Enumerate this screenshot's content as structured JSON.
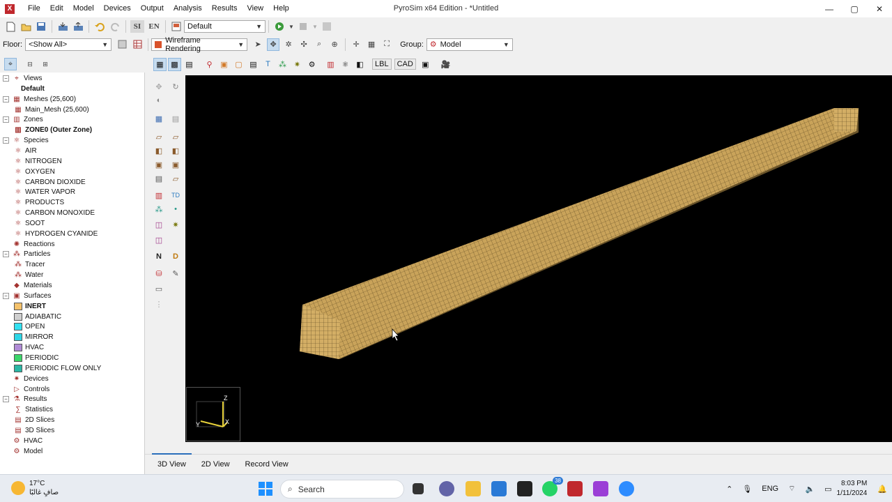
{
  "app": {
    "title": "PyroSim x64 Edition - *Untitled",
    "icon_glyph": "X",
    "menu": [
      "File",
      "Edit",
      "Model",
      "Devices",
      "Output",
      "Analysis",
      "Results",
      "View",
      "Help"
    ],
    "window_controls": [
      "—",
      "▢",
      "✕"
    ]
  },
  "toolbar1": {
    "units_si": "SI",
    "units_en": "EN",
    "view_combo": "Default"
  },
  "toolbar2": {
    "floor_label": "Floor:",
    "floor_value": "<Show All>",
    "render_mode": "Wireframe Rendering",
    "group_label": "Group:",
    "group_value": "Model"
  },
  "toolbar3": {
    "lbl_button": "LBL",
    "cad_button": "CAD"
  },
  "tree": [
    {
      "label": "Views",
      "level": 0,
      "expander": "−",
      "icon": "views-icon",
      "glyph": "⌖"
    },
    {
      "label": "Default",
      "level": 1,
      "bold": true
    },
    {
      "label": "Meshes (25,600)",
      "level": 0,
      "expander": "−",
      "icon": "mesh-icon",
      "glyph": "▦"
    },
    {
      "label": "Main_Mesh (25,600)",
      "level": 1,
      "icon": "mesh-icon",
      "glyph": "▦"
    },
    {
      "label": "Zones",
      "level": 0,
      "expander": "−",
      "icon": "zones-icon",
      "glyph": "▥"
    },
    {
      "label": "ZONE0 (Outer Zone)",
      "level": 1,
      "bold": true,
      "icon": "zone-icon",
      "glyph": "▥"
    },
    {
      "label": "Species",
      "level": 0,
      "expander": "−",
      "icon": "species-icon",
      "glyph": "⚛"
    },
    {
      "label": "AIR",
      "level": 1,
      "icon": "species-icon",
      "glyph": "⚛"
    },
    {
      "label": "NITROGEN",
      "level": 1,
      "icon": "species-icon",
      "glyph": "⚛"
    },
    {
      "label": "OXYGEN",
      "level": 1,
      "icon": "species-icon",
      "glyph": "⚛"
    },
    {
      "label": "CARBON DIOXIDE",
      "level": 1,
      "icon": "species-icon",
      "glyph": "⚛"
    },
    {
      "label": "WATER VAPOR",
      "level": 1,
      "icon": "species-icon",
      "glyph": "⚛"
    },
    {
      "label": "PRODUCTS",
      "level": 1,
      "icon": "species-icon",
      "glyph": "⚛"
    },
    {
      "label": "CARBON MONOXIDE",
      "level": 1,
      "icon": "species-icon",
      "glyph": "⚛"
    },
    {
      "label": "SOOT",
      "level": 1,
      "icon": "species-icon",
      "glyph": "⚛"
    },
    {
      "label": "HYDROGEN CYANIDE",
      "level": 1,
      "icon": "species-icon",
      "glyph": "⚛"
    },
    {
      "label": "Reactions",
      "level": 0,
      "icon": "reactions-icon",
      "glyph": "✺"
    },
    {
      "label": "Particles",
      "level": 0,
      "expander": "−",
      "icon": "particles-icon",
      "glyph": "⁂"
    },
    {
      "label": "Tracer",
      "level": 1,
      "icon": "particle-icon",
      "glyph": "⁂"
    },
    {
      "label": "Water",
      "level": 1,
      "icon": "particle-icon",
      "glyph": "⁂"
    },
    {
      "label": "Materials",
      "level": 0,
      "icon": "materials-icon",
      "glyph": "◆"
    },
    {
      "label": "Surfaces",
      "level": 0,
      "expander": "−",
      "icon": "surfaces-icon",
      "glyph": "▣"
    },
    {
      "label": "INERT",
      "level": 1,
      "bold": true,
      "swatch": "#f5c26b"
    },
    {
      "label": "ADIABATIC",
      "level": 1,
      "swatch": "#cfcfcf"
    },
    {
      "label": "OPEN",
      "level": 1,
      "swatch": "#33e0f0"
    },
    {
      "label": "MIRROR",
      "level": 1,
      "swatch": "#2fd6e6"
    },
    {
      "label": "HVAC",
      "level": 1,
      "swatch": "#b08bd6"
    },
    {
      "label": "PERIODIC",
      "level": 1,
      "swatch": "#3bd66a"
    },
    {
      "label": "PERIODIC FLOW ONLY",
      "level": 1,
      "swatch": "#2ab7a5"
    },
    {
      "label": "Devices",
      "level": 0,
      "icon": "devices-icon",
      "glyph": "✷"
    },
    {
      "label": "Controls",
      "level": 0,
      "icon": "controls-icon",
      "glyph": "▷"
    },
    {
      "label": "Results",
      "level": 0,
      "expander": "−",
      "icon": "results-icon",
      "glyph": "⚗"
    },
    {
      "label": "Statistics",
      "level": 1,
      "icon": "statistics-icon",
      "glyph": "∑"
    },
    {
      "label": "2D Slices",
      "level": 1,
      "icon": "slice2d-icon",
      "glyph": "▤"
    },
    {
      "label": "3D Slices",
      "level": 1,
      "icon": "slice3d-icon",
      "glyph": "▤"
    },
    {
      "label": "HVAC",
      "level": 0,
      "icon": "hvac-icon",
      "glyph": "⚙"
    },
    {
      "label": "Model",
      "level": 0,
      "icon": "model-icon",
      "glyph": "⚙"
    }
  ],
  "axes": {
    "z": "Z",
    "y": "Y",
    "x": "X"
  },
  "tabs": [
    "3D View",
    "2D View",
    "Record View"
  ],
  "taskbar": {
    "temperature": "17°C",
    "weather_text": "صافٍ غالبًا",
    "search_placeholder": "Search",
    "whatsapp_badge": "38",
    "language": "ENG",
    "time": "8:03 PM",
    "date": "1/11/2024"
  },
  "colors": {
    "mesh_top": "#c9a35a",
    "mesh_side": "#a68446",
    "mesh_grid": "#5a4520",
    "viewport_bg": "#000000",
    "brand_red": "#c0282d"
  }
}
